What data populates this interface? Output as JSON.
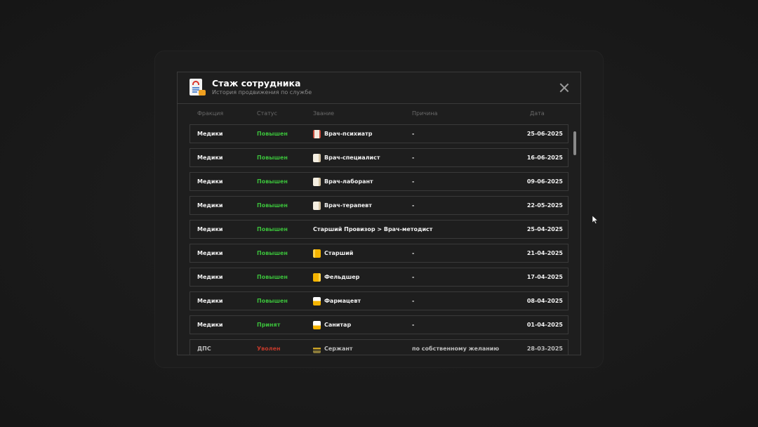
{
  "modal": {
    "title": "Стаж сотрудника",
    "subtitle": "История продвижения по службе"
  },
  "columns": {
    "faction": "Фракция",
    "status": "Статус",
    "rank": "Звание",
    "reason": "Причина",
    "date": "Дата"
  },
  "colors": {
    "promoted": "#3bbf3b",
    "hired": "#3bbf3b",
    "fired": "#c0392b"
  },
  "rows": [
    {
      "faction": "Медики",
      "status": "Повышен",
      "status_type": "promoted",
      "rank": "Врач-психиатр",
      "icon": "doctor-red-icon",
      "reason": "-",
      "date": "25-06-2025"
    },
    {
      "faction": "Медики",
      "status": "Повышен",
      "status_type": "promoted",
      "rank": "Врач-специалист",
      "icon": "doctor-coat-icon",
      "reason": "-",
      "date": "16-06-2025"
    },
    {
      "faction": "Медики",
      "status": "Повышен",
      "status_type": "promoted",
      "rank": "Врач-лаборант",
      "icon": "doctor-coat-icon",
      "reason": "-",
      "date": "09-06-2025"
    },
    {
      "faction": "Медики",
      "status": "Повышен",
      "status_type": "promoted",
      "rank": "Врач-терапевт",
      "icon": "doctor-coat-icon",
      "reason": "-",
      "date": "22-05-2025"
    },
    {
      "faction": "Медики",
      "status": "Повышен",
      "status_type": "promoted",
      "rank": "Старший Провизор > Врач-методист",
      "icon": "",
      "reason": "",
      "date": "25-04-2025"
    },
    {
      "faction": "Медики",
      "status": "Повышен",
      "status_type": "promoted",
      "rank": "Старший",
      "icon": "senior-coat-icon",
      "reason": "-",
      "date": "21-04-2025"
    },
    {
      "faction": "Медики",
      "status": "Повышен",
      "status_type": "promoted",
      "rank": "Фельдшер",
      "icon": "feldsher-coat-icon",
      "reason": "-",
      "date": "17-04-2025"
    },
    {
      "faction": "Медики",
      "status": "Повышен",
      "status_type": "promoted",
      "rank": "Фармацевт",
      "icon": "pharma-coat-icon",
      "reason": "-",
      "date": "08-04-2025"
    },
    {
      "faction": "Медики",
      "status": "Принят",
      "status_type": "hired",
      "rank": "Санитар",
      "icon": "sanitar-coat-icon",
      "reason": "-",
      "date": "01-04-2025"
    },
    {
      "faction": "ДПС",
      "status": "Уволен",
      "status_type": "fired",
      "rank": "Сержант",
      "icon": "sergeant-badge-icon",
      "reason": "по собственному желанию",
      "date": "28-03-2025"
    }
  ]
}
